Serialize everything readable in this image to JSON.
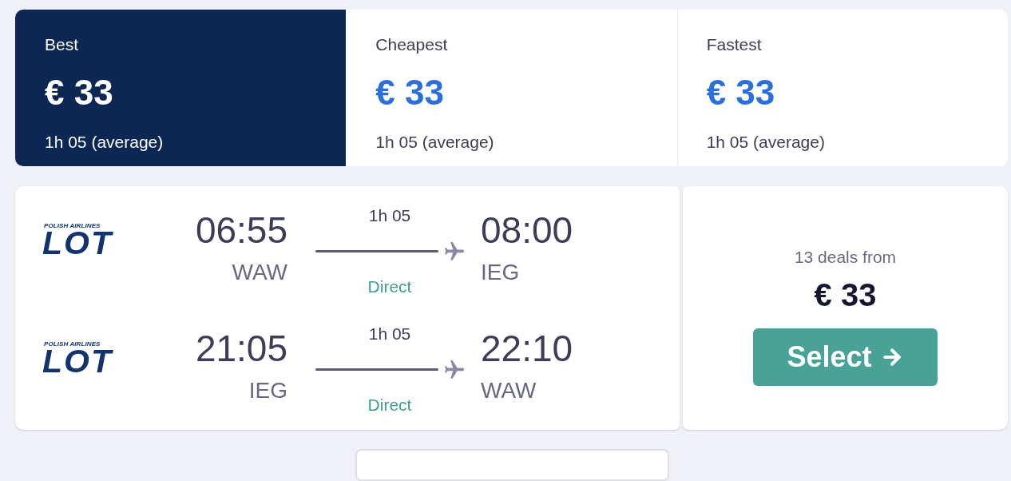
{
  "sort_tabs": [
    {
      "label": "Best",
      "price": "€ 33",
      "duration": "1h 05 (average)",
      "selected": true
    },
    {
      "label": "Cheapest",
      "price": "€ 33",
      "duration": "1h 05 (average)",
      "selected": false
    },
    {
      "label": "Fastest",
      "price": "€ 33",
      "duration": "1h 05 (average)",
      "selected": false
    }
  ],
  "itinerary": {
    "legs": [
      {
        "airline": {
          "caption": "POLISH AIRLINES",
          "wordmark": "LOT"
        },
        "departure": {
          "time": "06:55",
          "airport": "WAW"
        },
        "duration": "1h 05",
        "stops": "Direct",
        "arrival": {
          "time": "08:00",
          "airport": "IEG"
        }
      },
      {
        "airline": {
          "caption": "POLISH AIRLINES",
          "wordmark": "LOT"
        },
        "departure": {
          "time": "21:05",
          "airport": "IEG"
        },
        "duration": "1h 05",
        "stops": "Direct",
        "arrival": {
          "time": "22:10",
          "airport": "WAW"
        }
      }
    ],
    "deals": {
      "label": "13 deals from",
      "price": "€ 33",
      "button": "Select"
    }
  }
}
